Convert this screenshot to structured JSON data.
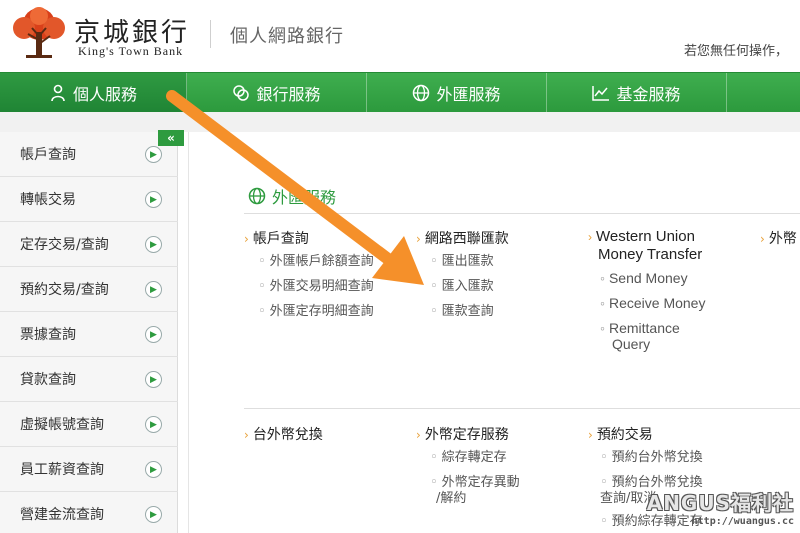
{
  "brand": {
    "name_zh": "京城銀行",
    "name_en": "King's Town Bank",
    "site_title": "個人網路銀行",
    "idle_note": "若您無任何操作，"
  },
  "nav": {
    "items": [
      {
        "label": "個人服務",
        "icon": "person-icon"
      },
      {
        "label": "銀行服務",
        "icon": "coins-icon"
      },
      {
        "label": "外匯服務",
        "icon": "globe-icon"
      },
      {
        "label": "基金服務",
        "icon": "line-chart-icon"
      }
    ]
  },
  "sidebar": {
    "toggle_label": "«",
    "items": [
      {
        "label": "帳戶查詢"
      },
      {
        "label": "轉帳交易"
      },
      {
        "label": "定存交易/查詢"
      },
      {
        "label": "預約交易/查詢"
      },
      {
        "label": "票據查詢"
      },
      {
        "label": "貸款查詢"
      },
      {
        "label": "虛擬帳號查詢"
      },
      {
        "label": "員工薪資查詢"
      },
      {
        "label": "營建金流查詢"
      }
    ]
  },
  "main": {
    "section_title": "外匯服務",
    "groups": [
      {
        "title": "帳戶查詢",
        "items": [
          "外匯帳戶餘額查詢",
          "外匯交易明細查詢",
          "外匯定存明細查詢"
        ]
      },
      {
        "title": "網路西聯匯款",
        "items": [
          "匯出匯款",
          "匯入匯款",
          "匯款查詢"
        ]
      },
      {
        "title_line1": "Western Union",
        "title_line2": "Money Transfer",
        "items": [
          "Send Money",
          "Receive Money",
          "Remittance",
          "Query"
        ]
      },
      {
        "title": "外幣"
      },
      {
        "title": "台外幣兌換",
        "items": []
      },
      {
        "title": "外幣定存服務",
        "items": [
          "綜存轉定存",
          "外幣定存異動",
          "/解約"
        ]
      },
      {
        "title": "預約交易",
        "items": [
          "預約台外幣兌換",
          "預約台外幣兌換",
          "查詢/取消",
          "預約綜存轉定存"
        ]
      }
    ]
  },
  "colors": {
    "nav_green": "#2e9b3f",
    "arrow_orange": "#f5902a",
    "caret_orange": "#e8a13a"
  },
  "watermark": {
    "main": "ANGUS福利社",
    "url": "http://wuangus.cc"
  }
}
